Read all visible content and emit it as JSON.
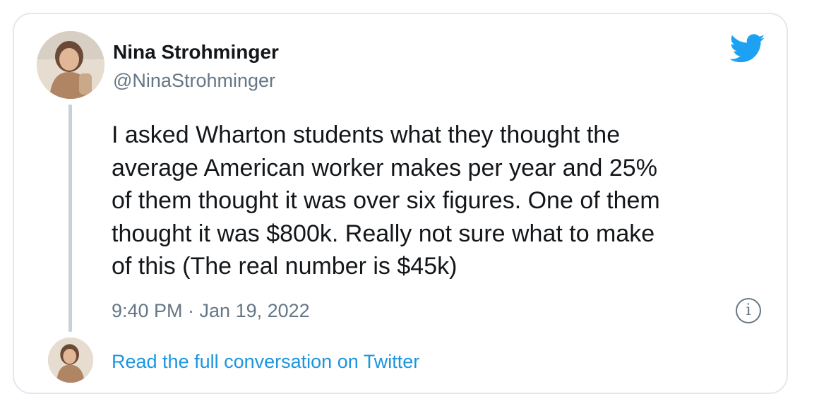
{
  "author": {
    "display_name": "Nina Strohminger",
    "handle": "@NinaStrohminger"
  },
  "tweet": {
    "lines": [
      "I asked Wharton students what they thought the",
      "average American worker makes per year and 25%",
      "of them thought it was over six figures. One of them",
      "thought it was $800k. Really not sure what to make",
      "of this (The real number is $45k)"
    ],
    "timestamp": "9:40 PM · Jan 19, 2022"
  },
  "footer": {
    "read_link": "Read the full conversation on Twitter"
  },
  "icons": {
    "brand": "twitter-bird-icon",
    "info": "info-icon"
  },
  "colors": {
    "brand_blue": "#1da1f2",
    "link_blue": "#1b95e0",
    "secondary_text": "#657786",
    "primary_text": "#14171a",
    "border": "#e1e8ed"
  }
}
